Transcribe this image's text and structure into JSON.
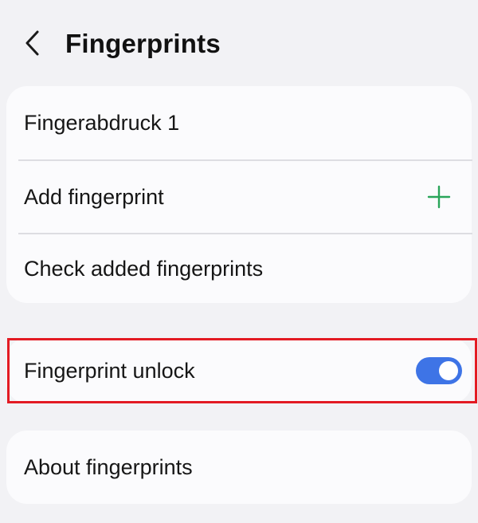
{
  "header": {
    "back_icon": "chevron-left-icon",
    "title": "Fingerprints"
  },
  "fingerprint_list": {
    "items": [
      {
        "label": "Fingerabdruck 1"
      },
      {
        "label": "Add fingerprint",
        "icon": "plus-icon",
        "icon_color": "#2aa55a"
      },
      {
        "label": "Check added fingerprints"
      }
    ]
  },
  "unlock": {
    "label": "Fingerprint unlock",
    "toggle_on": true,
    "toggle_color": "#3e74e6",
    "highlight_color": "#e31b23"
  },
  "about": {
    "label": "About fingerprints"
  }
}
